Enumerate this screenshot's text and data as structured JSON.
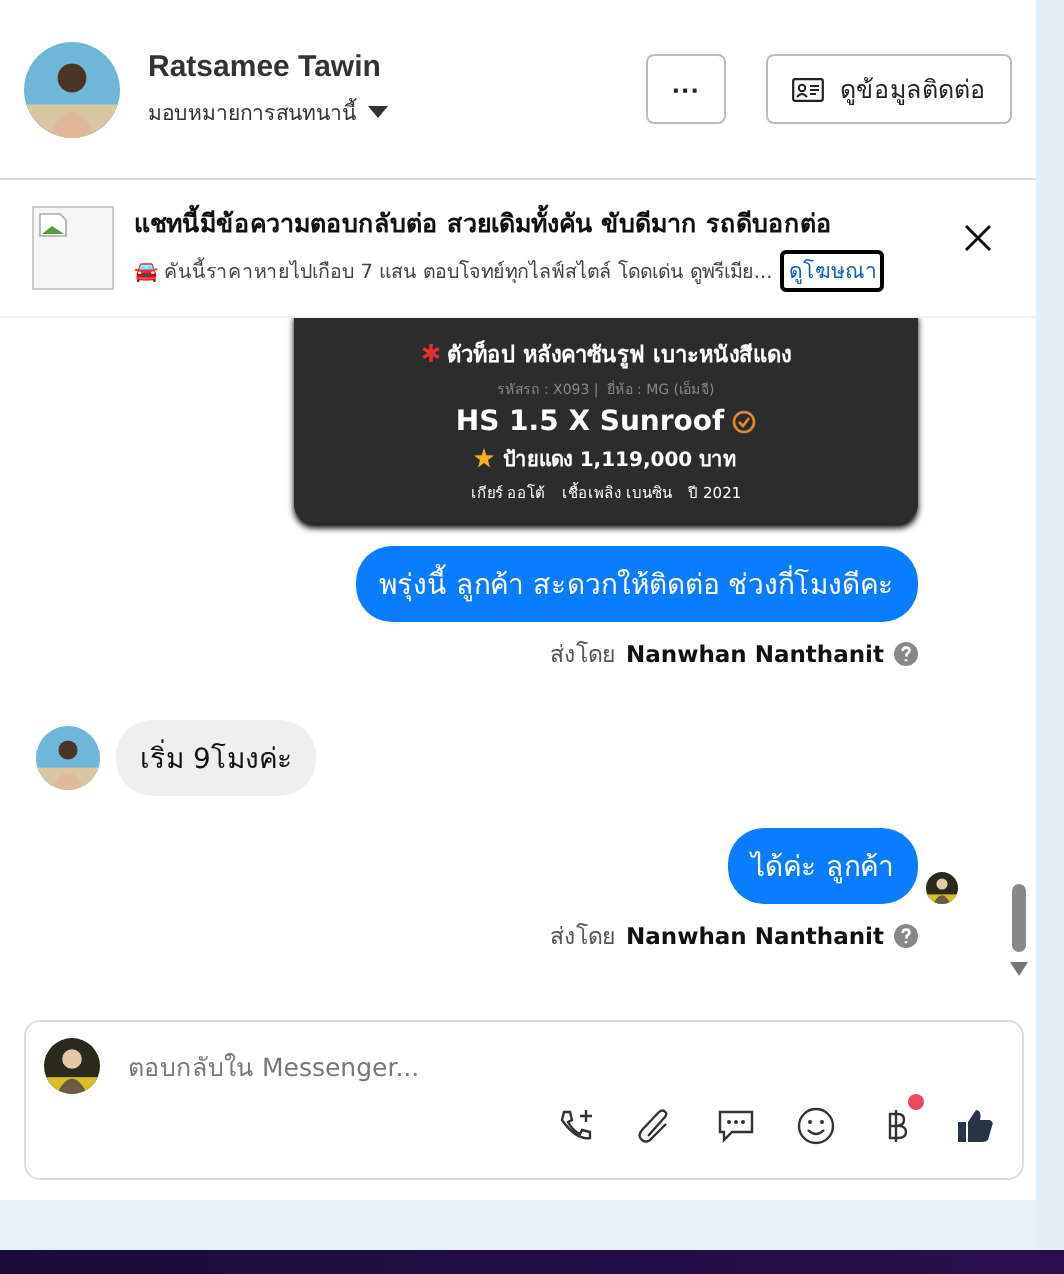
{
  "header": {
    "name": "Ratsamee Tawin",
    "subtitle": "มอบหมายการสนทนานี้",
    "more_button": "···",
    "contact_button": "ดูข้อมูลติดต่อ"
  },
  "ad": {
    "title": "แชทนี้มีข้อความตอบกลับต่อ สวยเดิมทั้งคัน ขับดีมาก รถดีบอกต่อ",
    "description": "🚘 คันนี้ราคาหายไปเกือบ 7 แสน ตอบโจทย์ทุกไลฟ์สไตล์ โดดเด่น ดูพรีเมีย...",
    "link": "ดูโฆษณา"
  },
  "messages": [
    {
      "kind": "card",
      "headline": "ตัวท็อป หลังคาซันรูฟ เบาะหนังสีแดง",
      "code": "รหัสรถ : X093 |",
      "brand": "ยี่ห้อ : MG (เอ็มจี)",
      "model": "HS 1.5 X Sunroof",
      "price": "ป้ายแดง 1,119,000 บาท",
      "specs": [
        "เกียร์ ออโต้",
        "เชื้อเพลิง เบนซิน",
        "ปี 2021"
      ]
    },
    {
      "kind": "outgoing",
      "text": "พรุ่งนี้ ลูกค้า  สะดวกให้ติดต่อ ช่วงกี่โมงดีคะ",
      "sent_by": "ส่งโดย",
      "sender": "Nanwhan Nanthanit",
      "seen": false
    },
    {
      "kind": "incoming",
      "text": "เริ่ม  9โมงค่ะ"
    },
    {
      "kind": "outgoing",
      "text": "ได้ค่ะ  ลูกค้า",
      "sent_by": "ส่งโดย",
      "sender": "Nanwhan Nanthanit",
      "seen": true
    }
  ],
  "composer": {
    "placeholder": "ตอบกลับใน Messenger...",
    "tools": [
      {
        "kind": "call",
        "notification": false
      },
      {
        "kind": "attach",
        "notification": false
      },
      {
        "kind": "reply",
        "notification": false
      },
      {
        "kind": "emoji",
        "notification": false
      },
      {
        "kind": "baht",
        "notification": true
      },
      {
        "kind": "like",
        "notification": false
      }
    ]
  }
}
